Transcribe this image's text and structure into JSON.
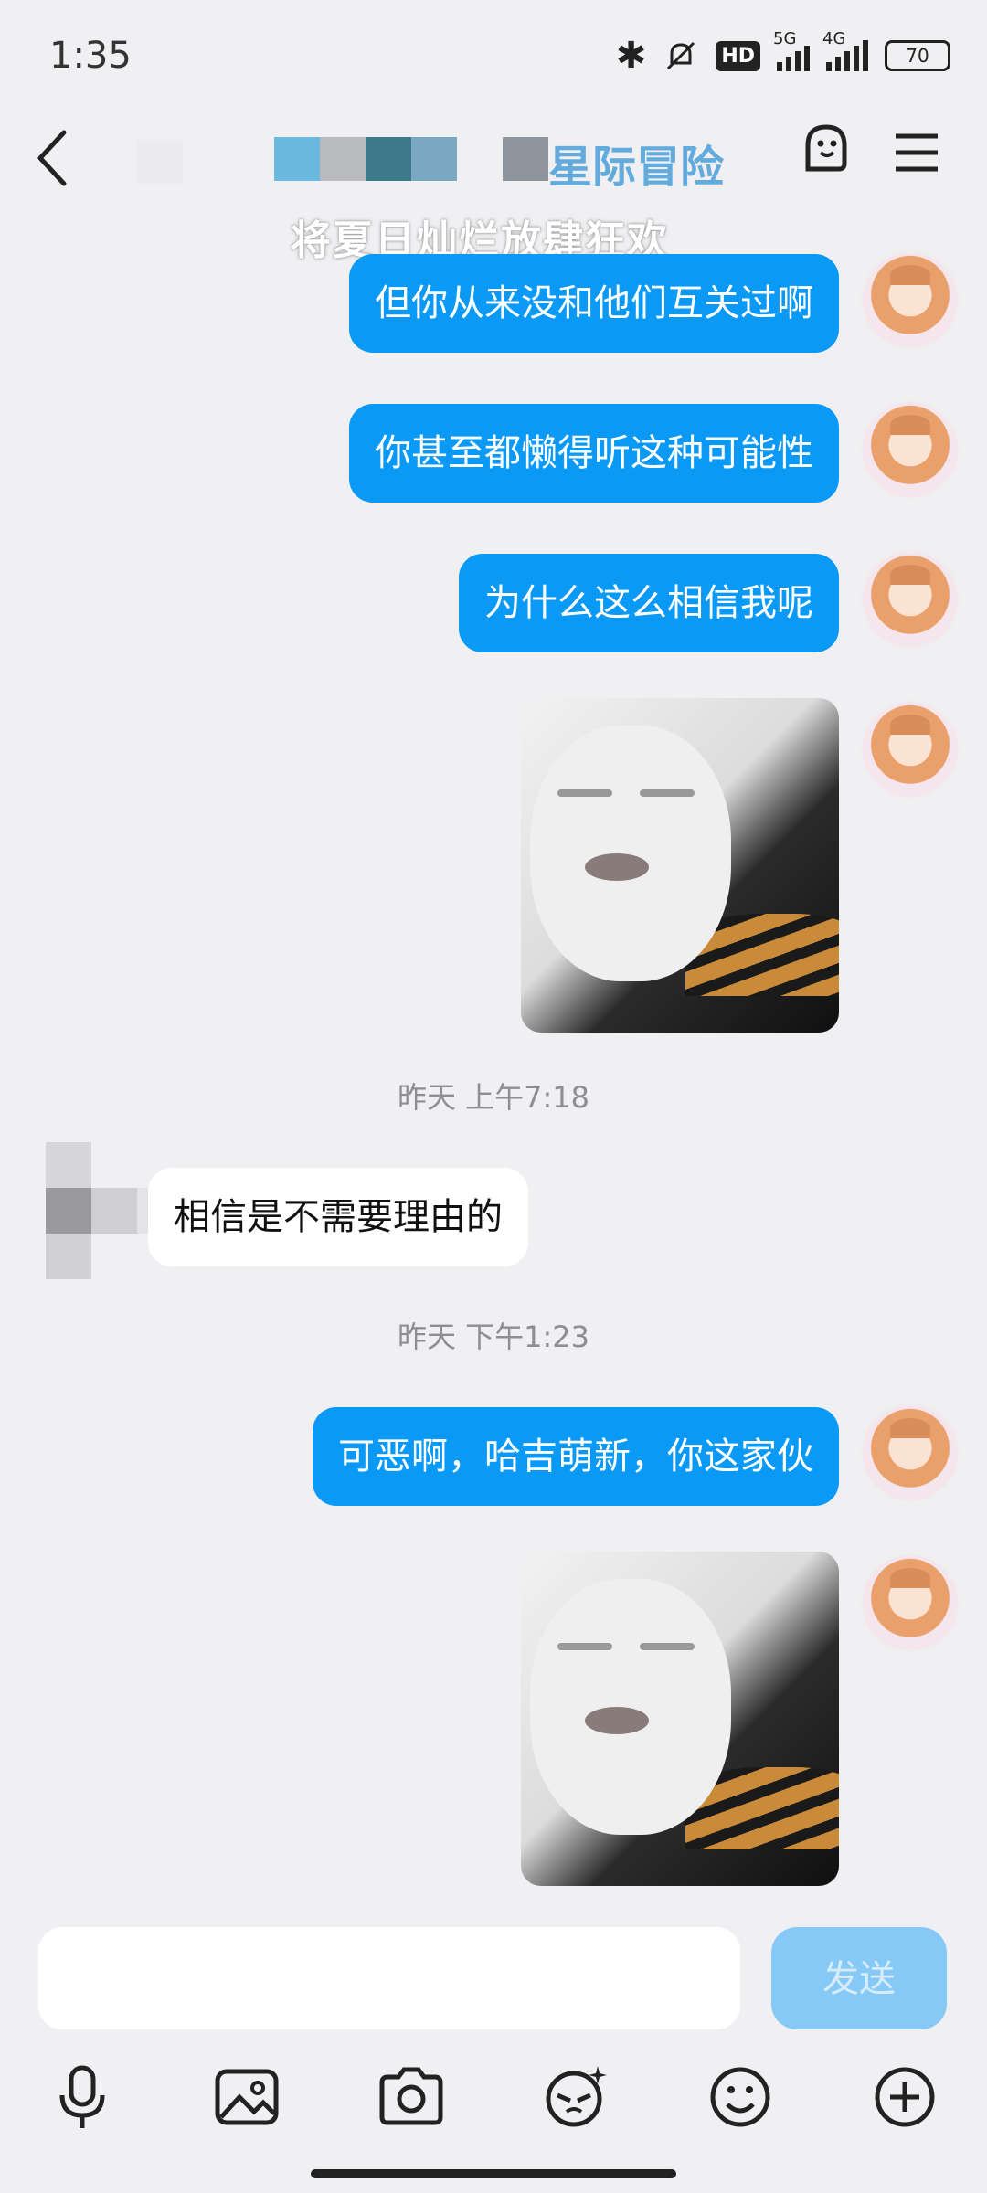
{
  "status_bar": {
    "time": "1:35",
    "network_hd": "HD",
    "network_5g": "5G",
    "network_4g": "4G",
    "battery": "70"
  },
  "header": {
    "title": "星际冒险",
    "subtitle": "将夏日灿烂放肆狂欢"
  },
  "messages": [
    {
      "type": "text",
      "direction": "out",
      "text": "但你从来没和他们互关过啊"
    },
    {
      "type": "text",
      "direction": "out",
      "text": "你甚至都懒得听这种可能性"
    },
    {
      "type": "text",
      "direction": "out",
      "text": "为什么这么相信我呢"
    },
    {
      "type": "image",
      "direction": "out"
    },
    {
      "type": "time",
      "text": "昨天 上午7:18"
    },
    {
      "type": "text",
      "direction": "in",
      "text": "相信是不需要理由的"
    },
    {
      "type": "time",
      "text": "昨天 下午1:23"
    },
    {
      "type": "text",
      "direction": "out",
      "text": "可恶啊，哈吉萌新，你这家伙"
    },
    {
      "type": "image",
      "direction": "out"
    }
  ],
  "input": {
    "placeholder": "",
    "send_label": "发送"
  },
  "toolbar": [
    "microphone-icon",
    "image-icon",
    "camera-icon",
    "face-edit-icon",
    "emoji-icon",
    "plus-icon"
  ],
  "colors": {
    "accent": "#0a99f5",
    "send_disabled": "#86c9f7",
    "background": "#f0f0f3"
  }
}
